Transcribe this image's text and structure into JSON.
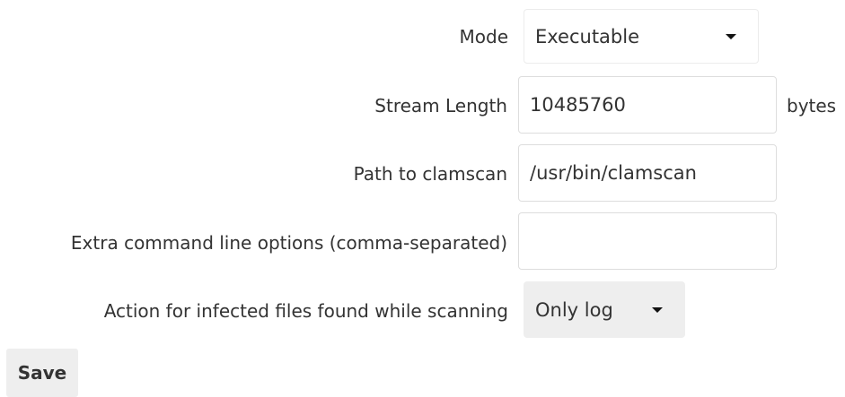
{
  "form": {
    "mode": {
      "label": "Mode",
      "value": "Executable",
      "icon": "chevron-down-icon"
    },
    "stream_length": {
      "label": "Stream Length",
      "value": "10485760",
      "suffix": "bytes"
    },
    "clamscan_path": {
      "label": "Path to clamscan",
      "value": "/usr/bin/clamscan"
    },
    "extra_options": {
      "label": "Extra command line options (comma-separated)",
      "value": ""
    },
    "infected_action": {
      "label": "Action for infected files found while scanning",
      "value": "Only log",
      "icon": "chevron-down-icon"
    }
  },
  "actions": {
    "save_label": "Save"
  }
}
